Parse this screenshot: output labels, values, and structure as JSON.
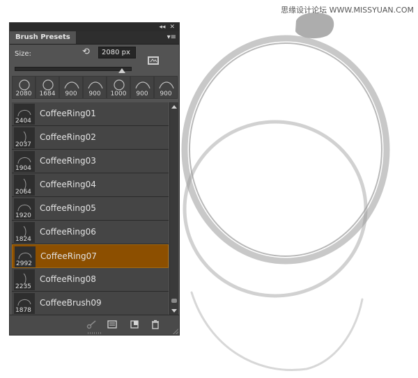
{
  "watermark": "思缘设计论坛 WWW.MISSYUAN.COM",
  "panel": {
    "title": "Brush Presets",
    "collapse_glyph": "◂◂",
    "close_glyph": "✕",
    "menu_glyph": "▾≡"
  },
  "size": {
    "label": "Size:",
    "value": "2080 px",
    "slider_fraction": 0.93
  },
  "recent_brushes": [
    {
      "size": "2080",
      "icon": "ring-icon"
    },
    {
      "size": "1684",
      "icon": "ring-icon"
    },
    {
      "size": "900",
      "icon": "arc-icon"
    },
    {
      "size": "900",
      "icon": "arc-icon"
    },
    {
      "size": "1000",
      "icon": "ring-icon"
    },
    {
      "size": "900",
      "icon": "arc-icon"
    },
    {
      "size": "900",
      "icon": "arc-icon"
    }
  ],
  "presets": [
    {
      "name": "CoffeeRing01",
      "size": "2404",
      "selected": false
    },
    {
      "name": "CoffeeRing02",
      "size": "2037",
      "selected": false
    },
    {
      "name": "CoffeeRing03",
      "size": "1904",
      "selected": false
    },
    {
      "name": "CoffeeRing04",
      "size": "2064",
      "selected": false
    },
    {
      "name": "CoffeeRing05",
      "size": "1920",
      "selected": false
    },
    {
      "name": "CoffeeRing06",
      "size": "1824",
      "selected": false
    },
    {
      "name": "CoffeeRing07",
      "size": "2992",
      "selected": true
    },
    {
      "name": "CoffeeRing08",
      "size": "2235",
      "selected": false
    },
    {
      "name": "CoffeeBrush09",
      "size": "1878",
      "selected": false
    }
  ],
  "colors": {
    "panel_bg": "#535353",
    "selected_row": "#8c4f00",
    "list_row": "#454545"
  }
}
